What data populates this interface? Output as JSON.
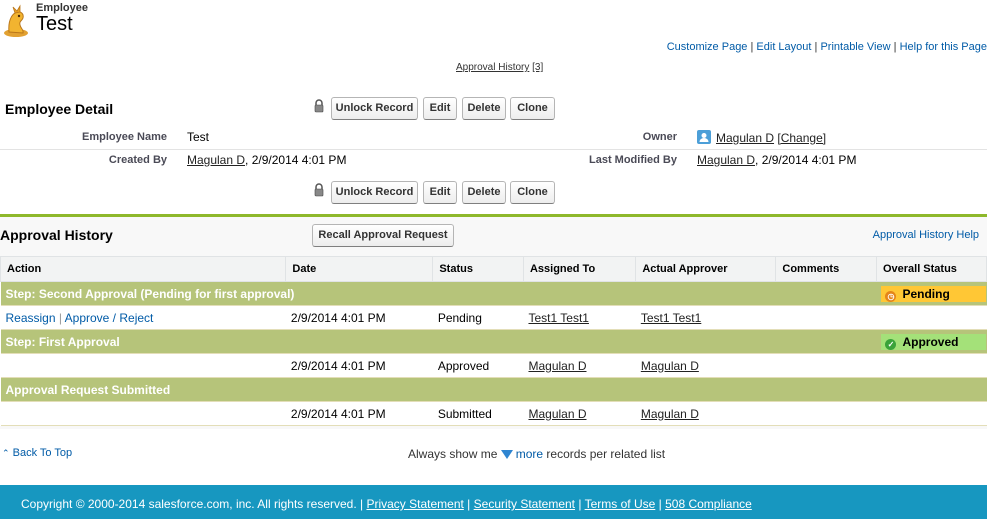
{
  "header": {
    "object_type": "Employee",
    "record_name": "Test",
    "links": [
      "Customize Page",
      "Edit Layout",
      "Printable View",
      "Help for this Page"
    ],
    "approval_history_link": "Approval History",
    "approval_history_count": "[3]"
  },
  "detail": {
    "title": "Employee Detail",
    "buttons": [
      "Unlock Record",
      "Edit",
      "Delete",
      "Clone"
    ],
    "fields": {
      "employee_name_label": "Employee Name",
      "employee_name_value": "Test",
      "owner_label": "Owner",
      "owner_value": "Magulan D",
      "owner_change": "[Change]",
      "created_by_label": "Created By",
      "created_by_user": "Magulan D",
      "created_by_date": ", 2/9/2014 4:01 PM",
      "last_modified_label": "Last Modified By",
      "last_modified_user": "Magulan D",
      "last_modified_date": ", 2/9/2014 4:01 PM"
    }
  },
  "approval": {
    "title": "Approval History",
    "recall_button": "Recall Approval Request",
    "help_link": "Approval History Help",
    "columns": [
      "Action",
      "Date",
      "Status",
      "Assigned To",
      "Actual Approver",
      "Comments",
      "Overall Status"
    ],
    "steps": [
      {
        "step_label": "Step: Second Approval (Pending for first approval)",
        "overall_status": "Pending",
        "row": {
          "action_reassign": "Reassign",
          "action_sep": " | ",
          "action_approve": "Approve / Reject",
          "date": "2/9/2014 4:01 PM",
          "status": "Pending",
          "assigned_to": "Test1 Test1",
          "actual_approver": "Test1 Test1",
          "comments": ""
        }
      },
      {
        "step_label": "Step: First Approval",
        "overall_status": "Approved",
        "row": {
          "date": "2/9/2014 4:01 PM",
          "status": "Approved",
          "assigned_to": "Magulan D",
          "actual_approver": "Magulan D",
          "comments": ""
        }
      },
      {
        "step_label": "Approval Request Submitted",
        "overall_status": "",
        "row": {
          "date": "2/9/2014 4:01 PM",
          "status": "Submitted",
          "assigned_to": "Magulan D",
          "actual_approver": "Magulan D",
          "comments": ""
        }
      }
    ]
  },
  "list_footer": {
    "back_to_top": "Back To Top",
    "always_show_prefix": "Always show me",
    "more_link": "more",
    "always_show_suffix": "records per related list"
  },
  "footer": {
    "copyright": "Copyright © 2000-2014 salesforce.com, inc. All rights reserved.",
    "links": [
      "Privacy Statement",
      "Security Statement",
      "Terms of Use",
      "508 Compliance"
    ]
  },
  "colors": {
    "accent_green": "#8eb82b",
    "step_row": "#b6c47a",
    "pending": "#ffc735",
    "approved": "#a4e179",
    "footer_bg": "#1797c0",
    "link": "#015ba7"
  },
  "icons": [
    "employee-object-icon",
    "lock-icon",
    "user-avatar-icon",
    "pending-clock-icon",
    "approved-check-icon",
    "back-to-top-arrow-icon",
    "more-triangle-icon"
  ]
}
